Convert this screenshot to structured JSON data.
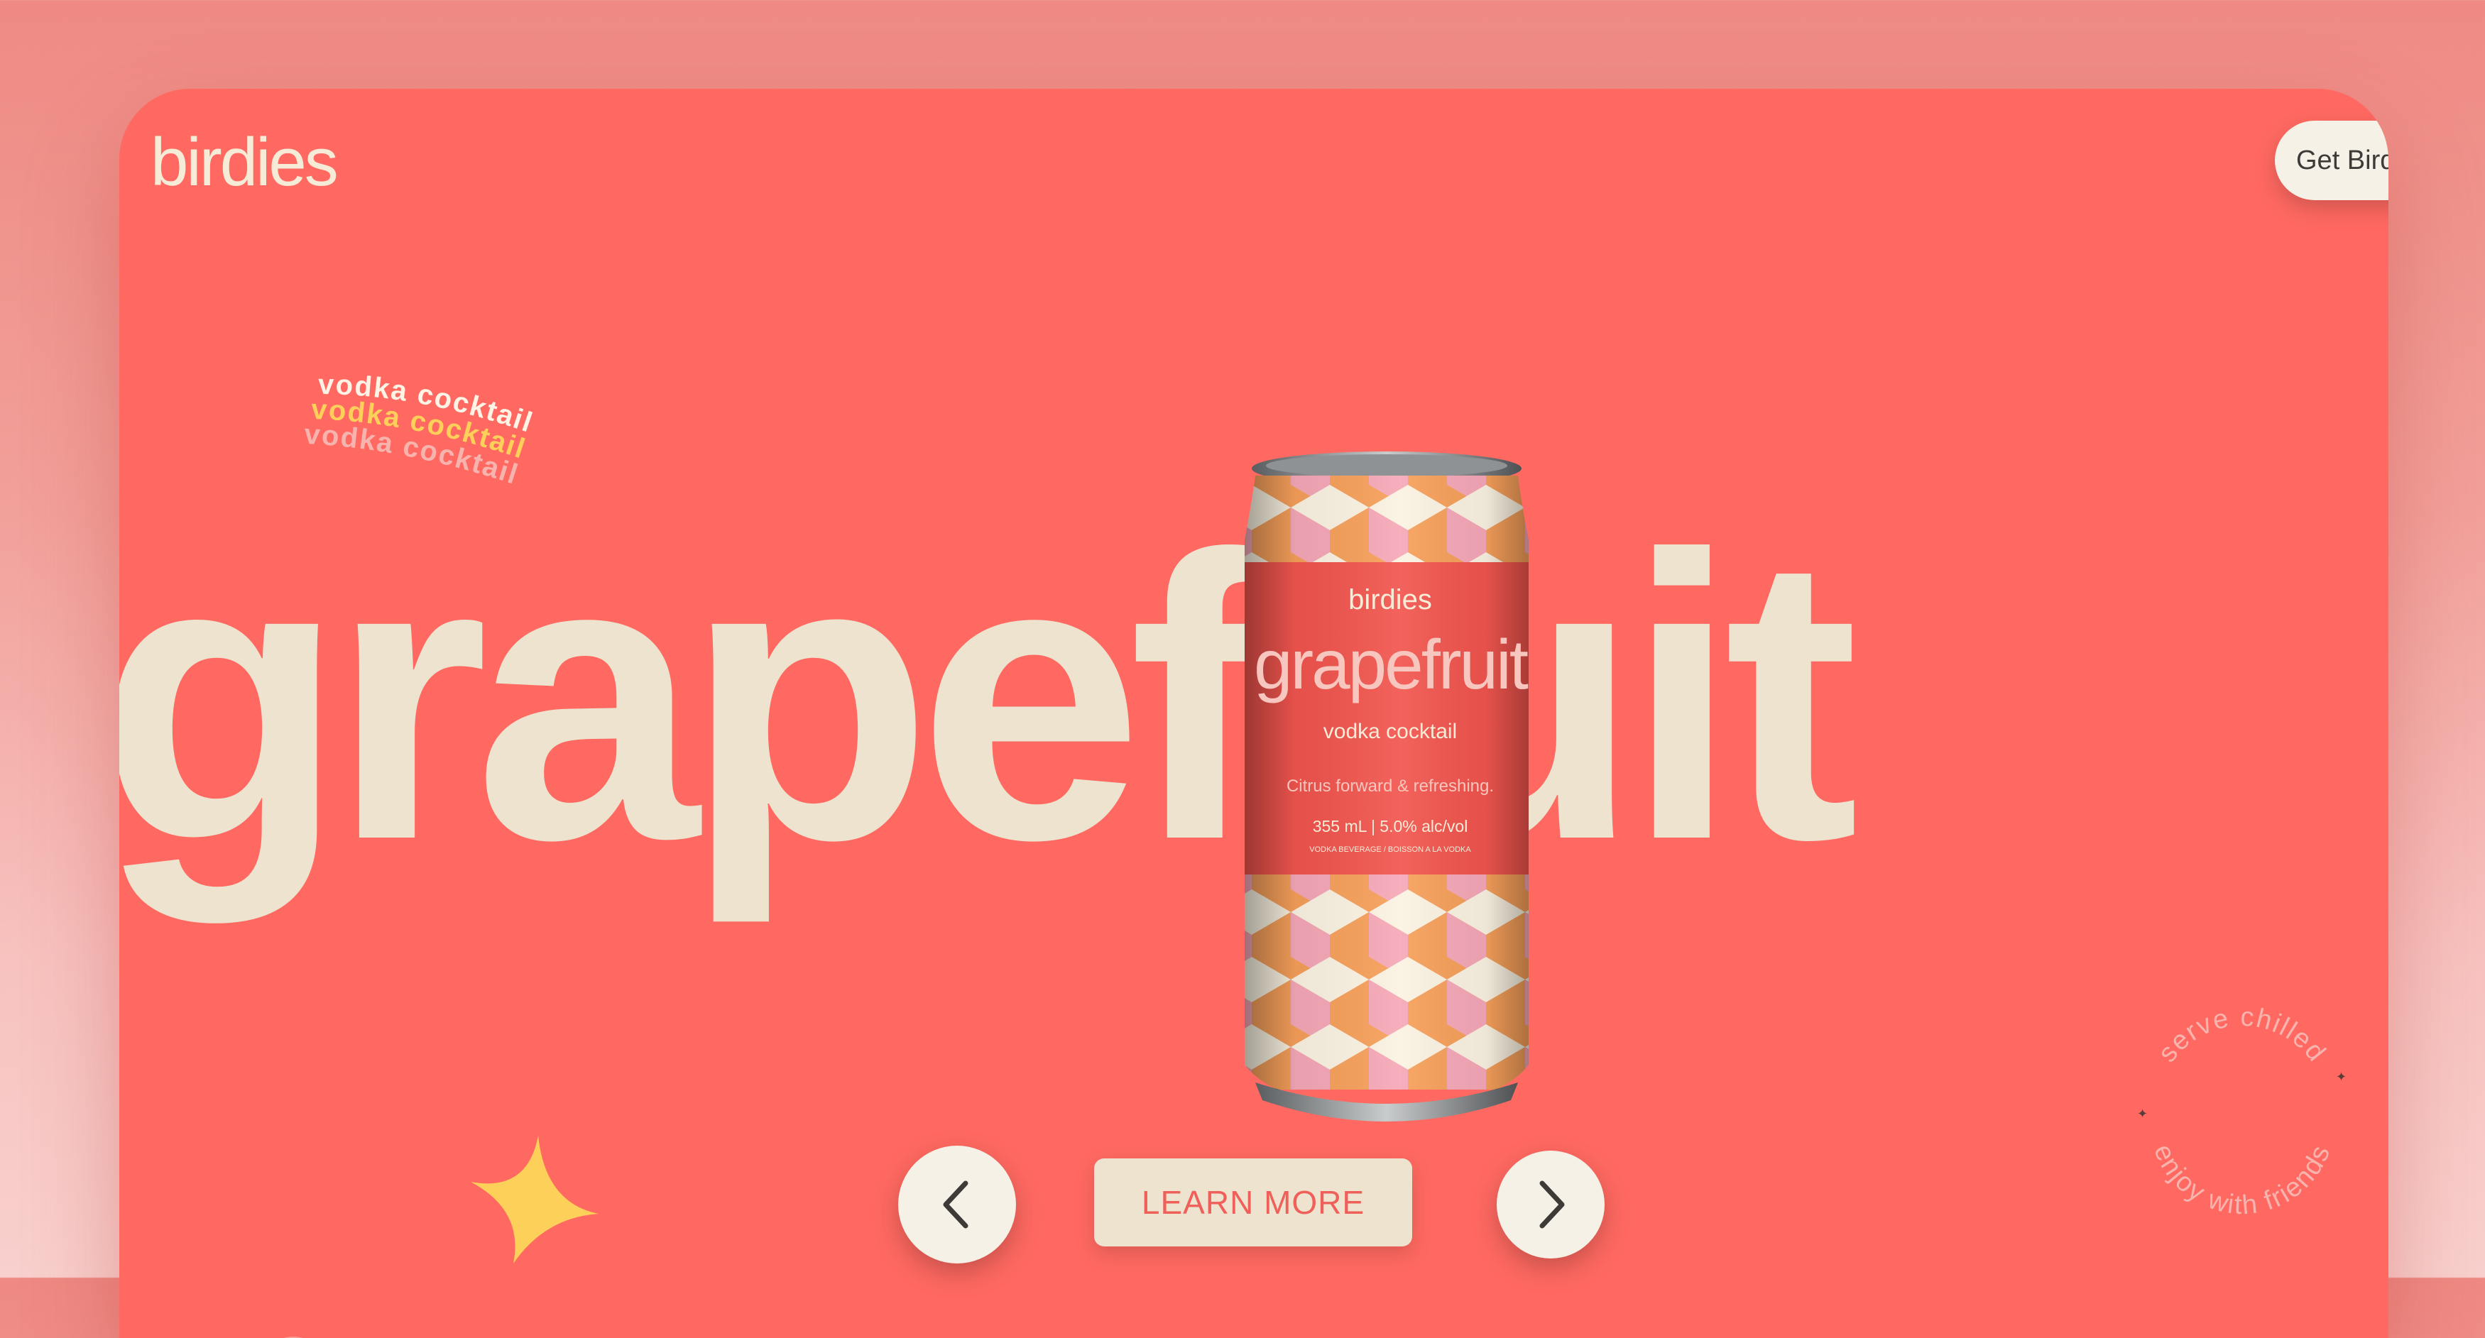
{
  "brand": {
    "logo": "birdies"
  },
  "header": {
    "cta_label": "Get Birdies"
  },
  "sticker": {
    "line1": "vodka cocktail",
    "line2": "vodka cocktail",
    "line3": "vodka cocktail"
  },
  "hero": {
    "flavor": "grapefruit"
  },
  "can": {
    "brand": "birdies",
    "flavor": "grapefruit",
    "type": "vodka cocktail",
    "tagline": "Citrus forward & refreshing.",
    "specs": "355 mL  |  5.0% alc/vol",
    "fine_print": "VODKA BEVERAGE / BOISSON A LA VODKA"
  },
  "badge": {
    "top_text": "serve chilled",
    "bottom_text": "enjoy with friends"
  },
  "carousel": {
    "learn_more_label": "LEARN MORE"
  },
  "colors": {
    "background": "#FF6961",
    "cream": "#EDE3CF",
    "yellow": "#FDD05A",
    "can_label": "#F2554E",
    "pink": "#F6A8B8",
    "orange": "#F7A05A"
  },
  "icons": {
    "prev": "chevron-left-icon",
    "next": "chevron-right-icon",
    "star": "sparkle-star-icon",
    "fingerprint": "fingerprint-icon"
  }
}
